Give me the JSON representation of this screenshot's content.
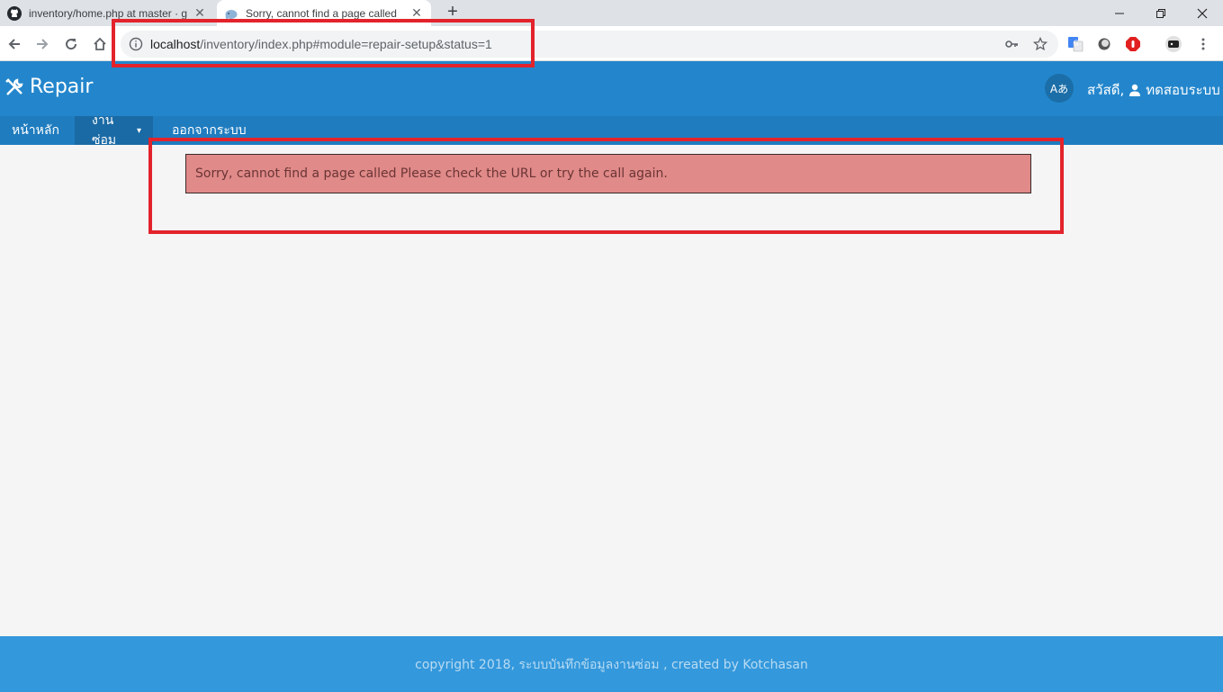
{
  "browser": {
    "tabs": [
      {
        "title": "inventory/home.php at master · g",
        "active": false,
        "icon": "github-icon"
      },
      {
        "title": "Sorry, cannot find a page called ",
        "active": true,
        "icon": "elephant-icon"
      }
    ],
    "new_tab_label": "+",
    "url_host": "localhost",
    "url_path": "/inventory/index.php#module=repair-setup&status=1"
  },
  "header": {
    "brand": "Repair",
    "lang_button": "Aあ",
    "greeting": "สวัสดี,",
    "user_name": "ทดสอบระบบ"
  },
  "nav": {
    "items": [
      {
        "label": "หน้าหลัก"
      },
      {
        "label": "งานซ่อม",
        "has_caret": true,
        "caret": "▾"
      },
      {
        "label": "ออกจากระบบ"
      }
    ]
  },
  "alert": {
    "message": "Sorry, cannot find a page called Please check the URL or try the call again."
  },
  "footer": {
    "text": "copyright 2018, ระบบบันทึกข้อมูลงานซ่อม , created by Kotchasan"
  },
  "colors": {
    "header": "#2386cc",
    "nav": "#1f7cbf",
    "alert_bg": "#e08a89",
    "footer": "#3498dc",
    "annotation": "#e3232c"
  }
}
